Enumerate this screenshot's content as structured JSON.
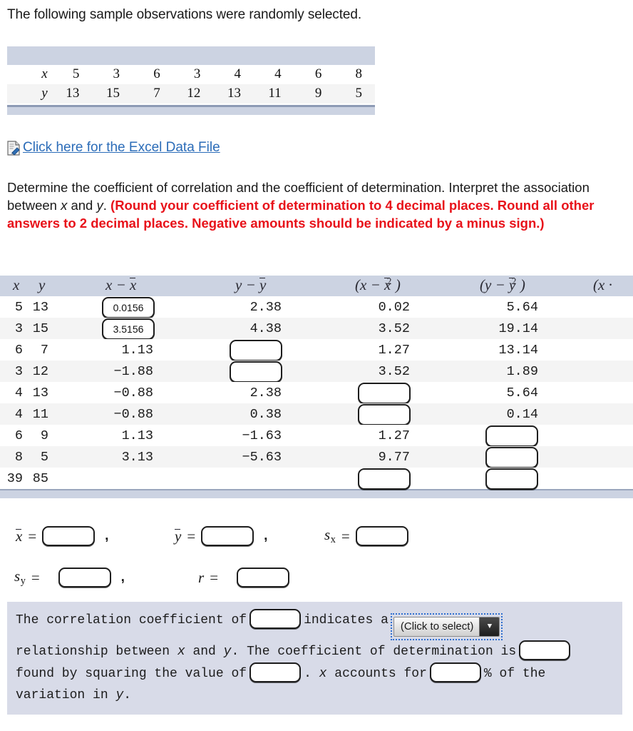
{
  "intro": {
    "text": "The following sample observations were randomly selected."
  },
  "obs_table": {
    "row_x_label": "x",
    "row_y_label": "y",
    "x": [
      "5",
      "3",
      "6",
      "3",
      "4",
      "4",
      "6",
      "8"
    ],
    "y": [
      "13",
      "15",
      "7",
      "12",
      "13",
      "11",
      "9",
      "5"
    ]
  },
  "excel": {
    "icon": "excel-file-icon",
    "link_text": " Click here for the Excel Data File"
  },
  "prompt": {
    "part1": "Determine the coefficient of correlation and the coefficient of determination. Interpret the association between ",
    "var_x": "x",
    "part2": " and ",
    "var_y": "y",
    "part3": ". ",
    "red": "(Round your coefficient of determination to 4 decimal places. Round all other answers to 2 decimal places. Negative amounts should be indicated by a minus sign.)"
  },
  "calc_table": {
    "headers": {
      "x": "x",
      "y": "y",
      "dx": "x − x̄",
      "dy": "y − ȳ",
      "dx2": "(x − x̄)²",
      "dy2": "(y − ȳ)²",
      "cross_partial": "(x ·"
    },
    "rows": [
      {
        "x": "5",
        "y": "13",
        "dx": {
          "type": "input",
          "value": "0.0156"
        },
        "dy": {
          "type": "text",
          "value": "2.38"
        },
        "dx2": {
          "type": "text",
          "value": "0.02"
        },
        "dy2": {
          "type": "text",
          "value": "5.64"
        }
      },
      {
        "x": "3",
        "y": "15",
        "dx": {
          "type": "input",
          "value": "3.5156"
        },
        "dy": {
          "type": "text",
          "value": "4.38"
        },
        "dx2": {
          "type": "text",
          "value": "3.52"
        },
        "dy2": {
          "type": "text",
          "value": "19.14"
        }
      },
      {
        "x": "6",
        "y": "7",
        "dx": {
          "type": "text",
          "value": "1.13"
        },
        "dy": {
          "type": "input",
          "value": ""
        },
        "dx2": {
          "type": "text",
          "value": "1.27"
        },
        "dy2": {
          "type": "text",
          "value": "13.14"
        }
      },
      {
        "x": "3",
        "y": "12",
        "dx": {
          "type": "text",
          "value": "−1.88"
        },
        "dy": {
          "type": "input",
          "value": ""
        },
        "dx2": {
          "type": "text",
          "value": "3.52"
        },
        "dy2": {
          "type": "text",
          "value": "1.89"
        }
      },
      {
        "x": "4",
        "y": "13",
        "dx": {
          "type": "text",
          "value": "−0.88"
        },
        "dy": {
          "type": "text",
          "value": "2.38"
        },
        "dx2": {
          "type": "input",
          "value": ""
        },
        "dy2": {
          "type": "text",
          "value": "5.64"
        }
      },
      {
        "x": "4",
        "y": "11",
        "dx": {
          "type": "text",
          "value": "−0.88"
        },
        "dy": {
          "type": "text",
          "value": "0.38"
        },
        "dx2": {
          "type": "input",
          "value": ""
        },
        "dy2": {
          "type": "text",
          "value": "0.14"
        }
      },
      {
        "x": "6",
        "y": "9",
        "dx": {
          "type": "text",
          "value": "1.13"
        },
        "dy": {
          "type": "text",
          "value": "−1.63"
        },
        "dx2": {
          "type": "text",
          "value": "1.27"
        },
        "dy2": {
          "type": "input",
          "value": ""
        }
      },
      {
        "x": "8",
        "y": "5",
        "dx": {
          "type": "text",
          "value": "3.13"
        },
        "dy": {
          "type": "text",
          "value": "−5.63"
        },
        "dx2": {
          "type": "text",
          "value": "9.77"
        },
        "dy2": {
          "type": "input",
          "value": ""
        }
      },
      {
        "x": "39",
        "y": "85",
        "dx": {
          "type": "text",
          "value": ""
        },
        "dy": {
          "type": "text",
          "value": ""
        },
        "dx2": {
          "type": "input",
          "value": ""
        },
        "dy2": {
          "type": "input",
          "value": ""
        }
      }
    ]
  },
  "stats": {
    "xbar_label": "x̄",
    "ybar_label": "ȳ",
    "sx_label": "s",
    "sx_sub": "x",
    "sy_label": "s",
    "sy_sub": "y",
    "r_label": "r",
    "equals": "=",
    "comma": ",",
    "xbar_value": "",
    "ybar_value": "",
    "sx_value": "",
    "sy_value": "",
    "r_value": ""
  },
  "conclusion": {
    "t1": "The correlation coefficient of",
    "in1": "",
    "t2": "indicates a",
    "select_value": "(Click to select)",
    "select_arrow": "▼",
    "t3": "relationship between ",
    "var_x": "x",
    "t4": " and ",
    "var_y": "y",
    "t5": ". The coefficient of determination is",
    "in2": "",
    "t6": "found by squaring the value of",
    "in3": "",
    "t7": ". ",
    "var_x2": "x",
    "t8": " accounts for",
    "in4": "",
    "t9": "% of the",
    "t10": "variation in ",
    "var_y2": "y",
    "t11": "."
  }
}
